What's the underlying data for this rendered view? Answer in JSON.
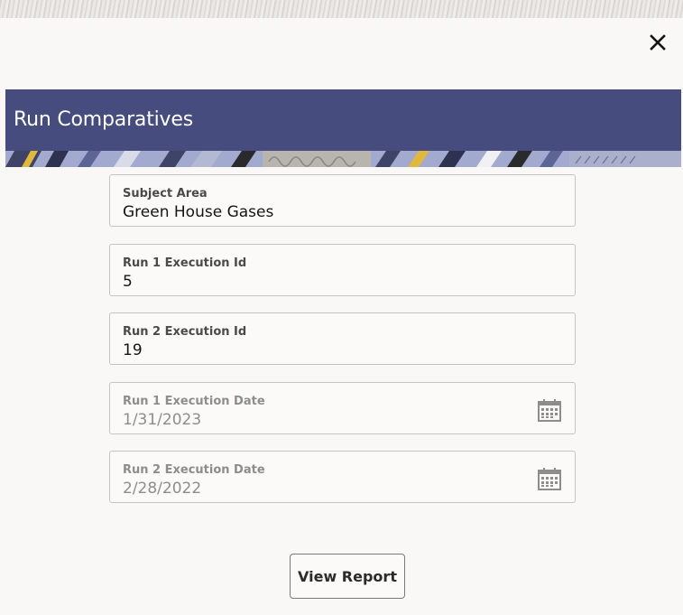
{
  "dialog": {
    "title": "Run Comparatives",
    "close_icon": "close-icon",
    "accent_color": "#464d7e"
  },
  "fields": {
    "subject_area": {
      "label": "Subject Area",
      "value": "Green House Gases"
    },
    "run1_execution_id": {
      "label": "Run 1 Execution Id",
      "value": "5"
    },
    "run2_execution_id": {
      "label": "Run 2 Execution Id",
      "value": "19"
    },
    "run1_execution_date": {
      "label": "Run 1 Execution Date",
      "value": "1/31/2023",
      "icon": "calendar-icon",
      "disabled": true
    },
    "run2_execution_date": {
      "label": "Run 2 Execution Date",
      "value": "2/28/2022",
      "icon": "calendar-icon",
      "disabled": true
    }
  },
  "actions": {
    "view_report_label": "View Report"
  }
}
